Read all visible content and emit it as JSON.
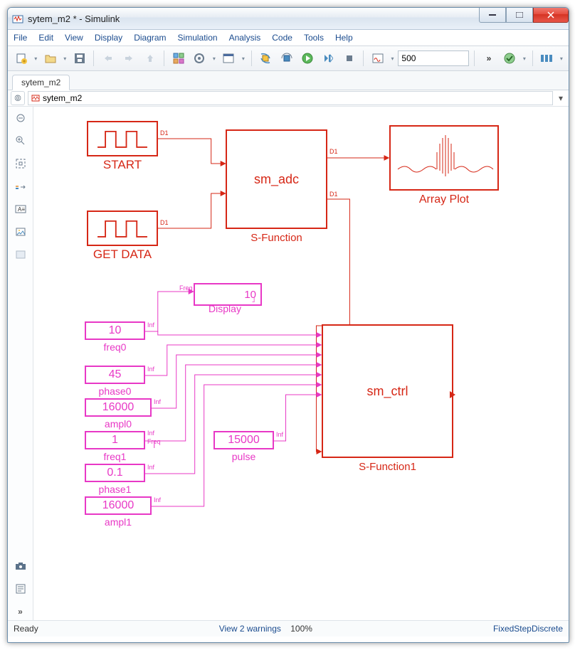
{
  "window": {
    "title": "sytem_m2 * - Simulink"
  },
  "menu": [
    "File",
    "Edit",
    "View",
    "Display",
    "Diagram",
    "Simulation",
    "Analysis",
    "Code",
    "Tools",
    "Help"
  ],
  "toolbar": {
    "stop_time": "500"
  },
  "tab": "sytem_m2",
  "path": "sytem_m2",
  "diagram": {
    "start": "START",
    "getdata": "GET DATA",
    "sfunc0_name": "sm_adc",
    "sfunc0_label": "S-Function",
    "arrayplot": "Array Plot",
    "sfunc1_name": "sm_ctrl",
    "sfunc1_label": "S-Function1",
    "display_label": "Display",
    "display_val": "10",
    "ports": {
      "d1": "D1",
      "inf": "Inf",
      "freq": "Freq"
    },
    "consts": {
      "freq0": {
        "v": "10",
        "n": "freq0"
      },
      "phase0": {
        "v": "45",
        "n": "phase0"
      },
      "ampl0": {
        "v": "16000",
        "n": "ampl0"
      },
      "freq1": {
        "v": "1",
        "n": "freq1"
      },
      "phase1": {
        "v": "0.1",
        "n": "phase1"
      },
      "ampl1": {
        "v": "16000",
        "n": "ampl1"
      },
      "pulse": {
        "v": "15000",
        "n": "pulse"
      }
    }
  },
  "status": {
    "ready": "Ready",
    "warnings": "View 2 warnings",
    "zoom": "100%",
    "solver": "FixedStepDiscrete"
  }
}
